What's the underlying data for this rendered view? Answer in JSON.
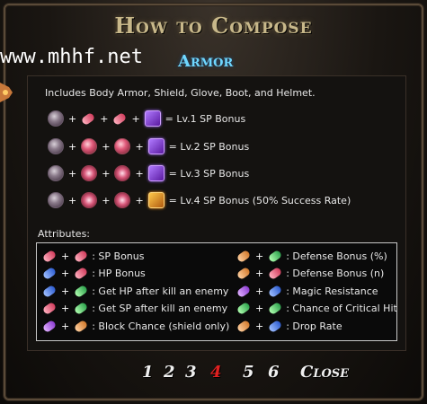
{
  "window": {
    "title": "How to Compose",
    "subtitle": "Armor",
    "watermark": "www.mhhf.net"
  },
  "intro": "Includes Body Armor, Shield, Glove, Boot, and Helmet.",
  "recipes": [
    {
      "result": "= Lv.1 SP Bonus",
      "items": [
        "round-gem",
        "pill-red",
        "pill-red",
        "purple-crystal"
      ]
    },
    {
      "result": "= Lv.2 SP Bonus",
      "items": [
        "round-gem",
        "round-red-gem",
        "round-red-gem",
        "purple-crystal"
      ]
    },
    {
      "result": "= Lv.3 SP Bonus",
      "items": [
        "round-gem",
        "flake-gem",
        "flake-gem",
        "purple-crystal"
      ]
    },
    {
      "result": "= Lv.4 SP Bonus (50% Success Rate)",
      "items": [
        "round-gem",
        "flake-gem",
        "flake-gem",
        "orange-crystal"
      ]
    }
  ],
  "attributes": {
    "heading": "Attributes:",
    "left": [
      {
        "a": "red",
        "b": "red",
        "label": ": SP Bonus"
      },
      {
        "a": "blue",
        "b": "red",
        "label": ": HP Bonus"
      },
      {
        "a": "blue",
        "b": "green",
        "label": ": Get HP after kill an enemy"
      },
      {
        "a": "red",
        "b": "green",
        "label": ": Get SP after kill an enemy"
      },
      {
        "a": "purple",
        "b": "orange",
        "label": ": Block Chance (shield only)"
      }
    ],
    "right": [
      {
        "a": "orange",
        "b": "green",
        "label": ": Defense Bonus (%)"
      },
      {
        "a": "orange",
        "b": "red",
        "label": ": Defense Bonus (n)"
      },
      {
        "a": "purple",
        "b": "blue",
        "label": ": Magic Resistance"
      },
      {
        "a": "green",
        "b": "green",
        "label": ": Chance of Critical Hit"
      },
      {
        "a": "orange",
        "b": "blue",
        "label": ": Drop Rate"
      }
    ]
  },
  "nav": {
    "pages": [
      "1",
      "2",
      "3",
      "4",
      "5",
      "6"
    ],
    "active_page": "4",
    "close_label": "Close"
  },
  "colors": {
    "title": "#c8b88a",
    "subtitle": "#6fd7ff",
    "active_page": "#e02020",
    "text": "#e8e8e8"
  }
}
